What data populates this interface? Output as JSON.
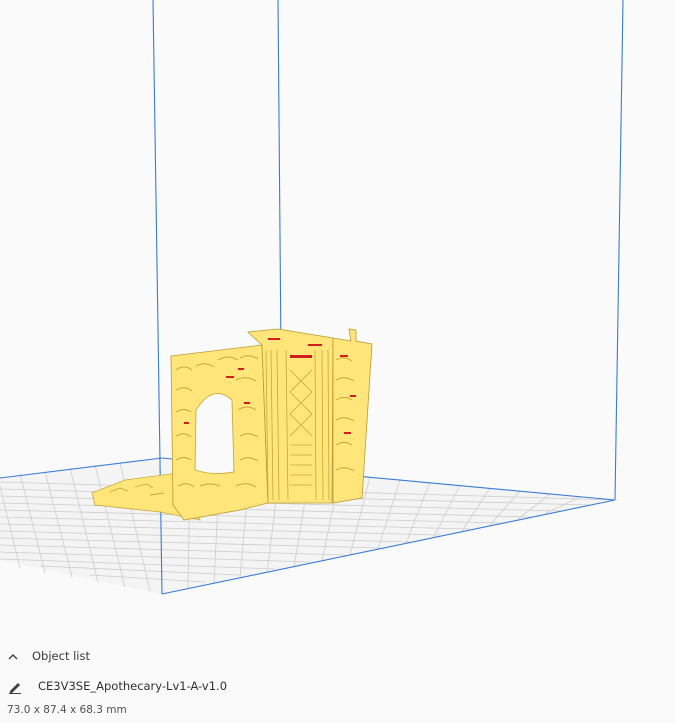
{
  "object_list": {
    "header_label": "Object list",
    "toggle_icon": "chevron-up-icon",
    "edit_icon": "pencil-icon",
    "object_name": "CE3V3SE_Apothecary-Lv1-A-v1.0",
    "dimensions": "73.0 x 87.4 x 68.3 mm"
  },
  "colors": {
    "build_volume_edge": "#2f6fcf",
    "grid_line": "#c8c8c8",
    "plate": "#f4f4f4",
    "model": "#ffe57a",
    "model_shadow": "#d8bb3e",
    "overhang": "#d21e1e"
  }
}
